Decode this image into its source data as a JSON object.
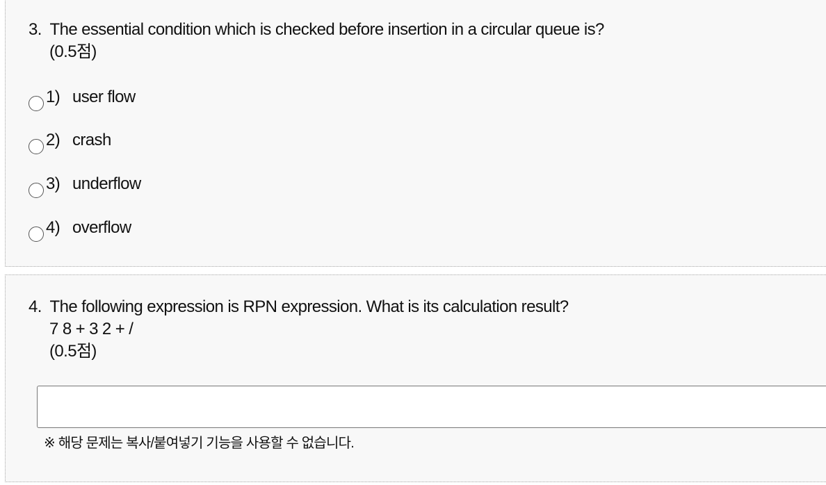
{
  "question3": {
    "title_line1": "3.  The essential condition which is checked before insertion in a circular queue is?",
    "title_line2": "(0.5점)",
    "options": [
      {
        "num": "1)",
        "text": "user flow"
      },
      {
        "num": "2)",
        "text": "crash"
      },
      {
        "num": "3)",
        "text": "underflow"
      },
      {
        "num": "4)",
        "text": "overflow"
      }
    ]
  },
  "question4": {
    "title_line1": "4.  The following expression is RPN expression. What is its calculation result?",
    "title_line2": "7 8 + 3 2 + /",
    "title_line3": "(0.5점)",
    "answer_value": "",
    "notice": "※ 해당 문제는 복사/붙여넣기 기능을 사용할 수 없습니다."
  },
  "colors": {
    "card_background": "#f8f8f8",
    "border": "#aaaaaa"
  }
}
